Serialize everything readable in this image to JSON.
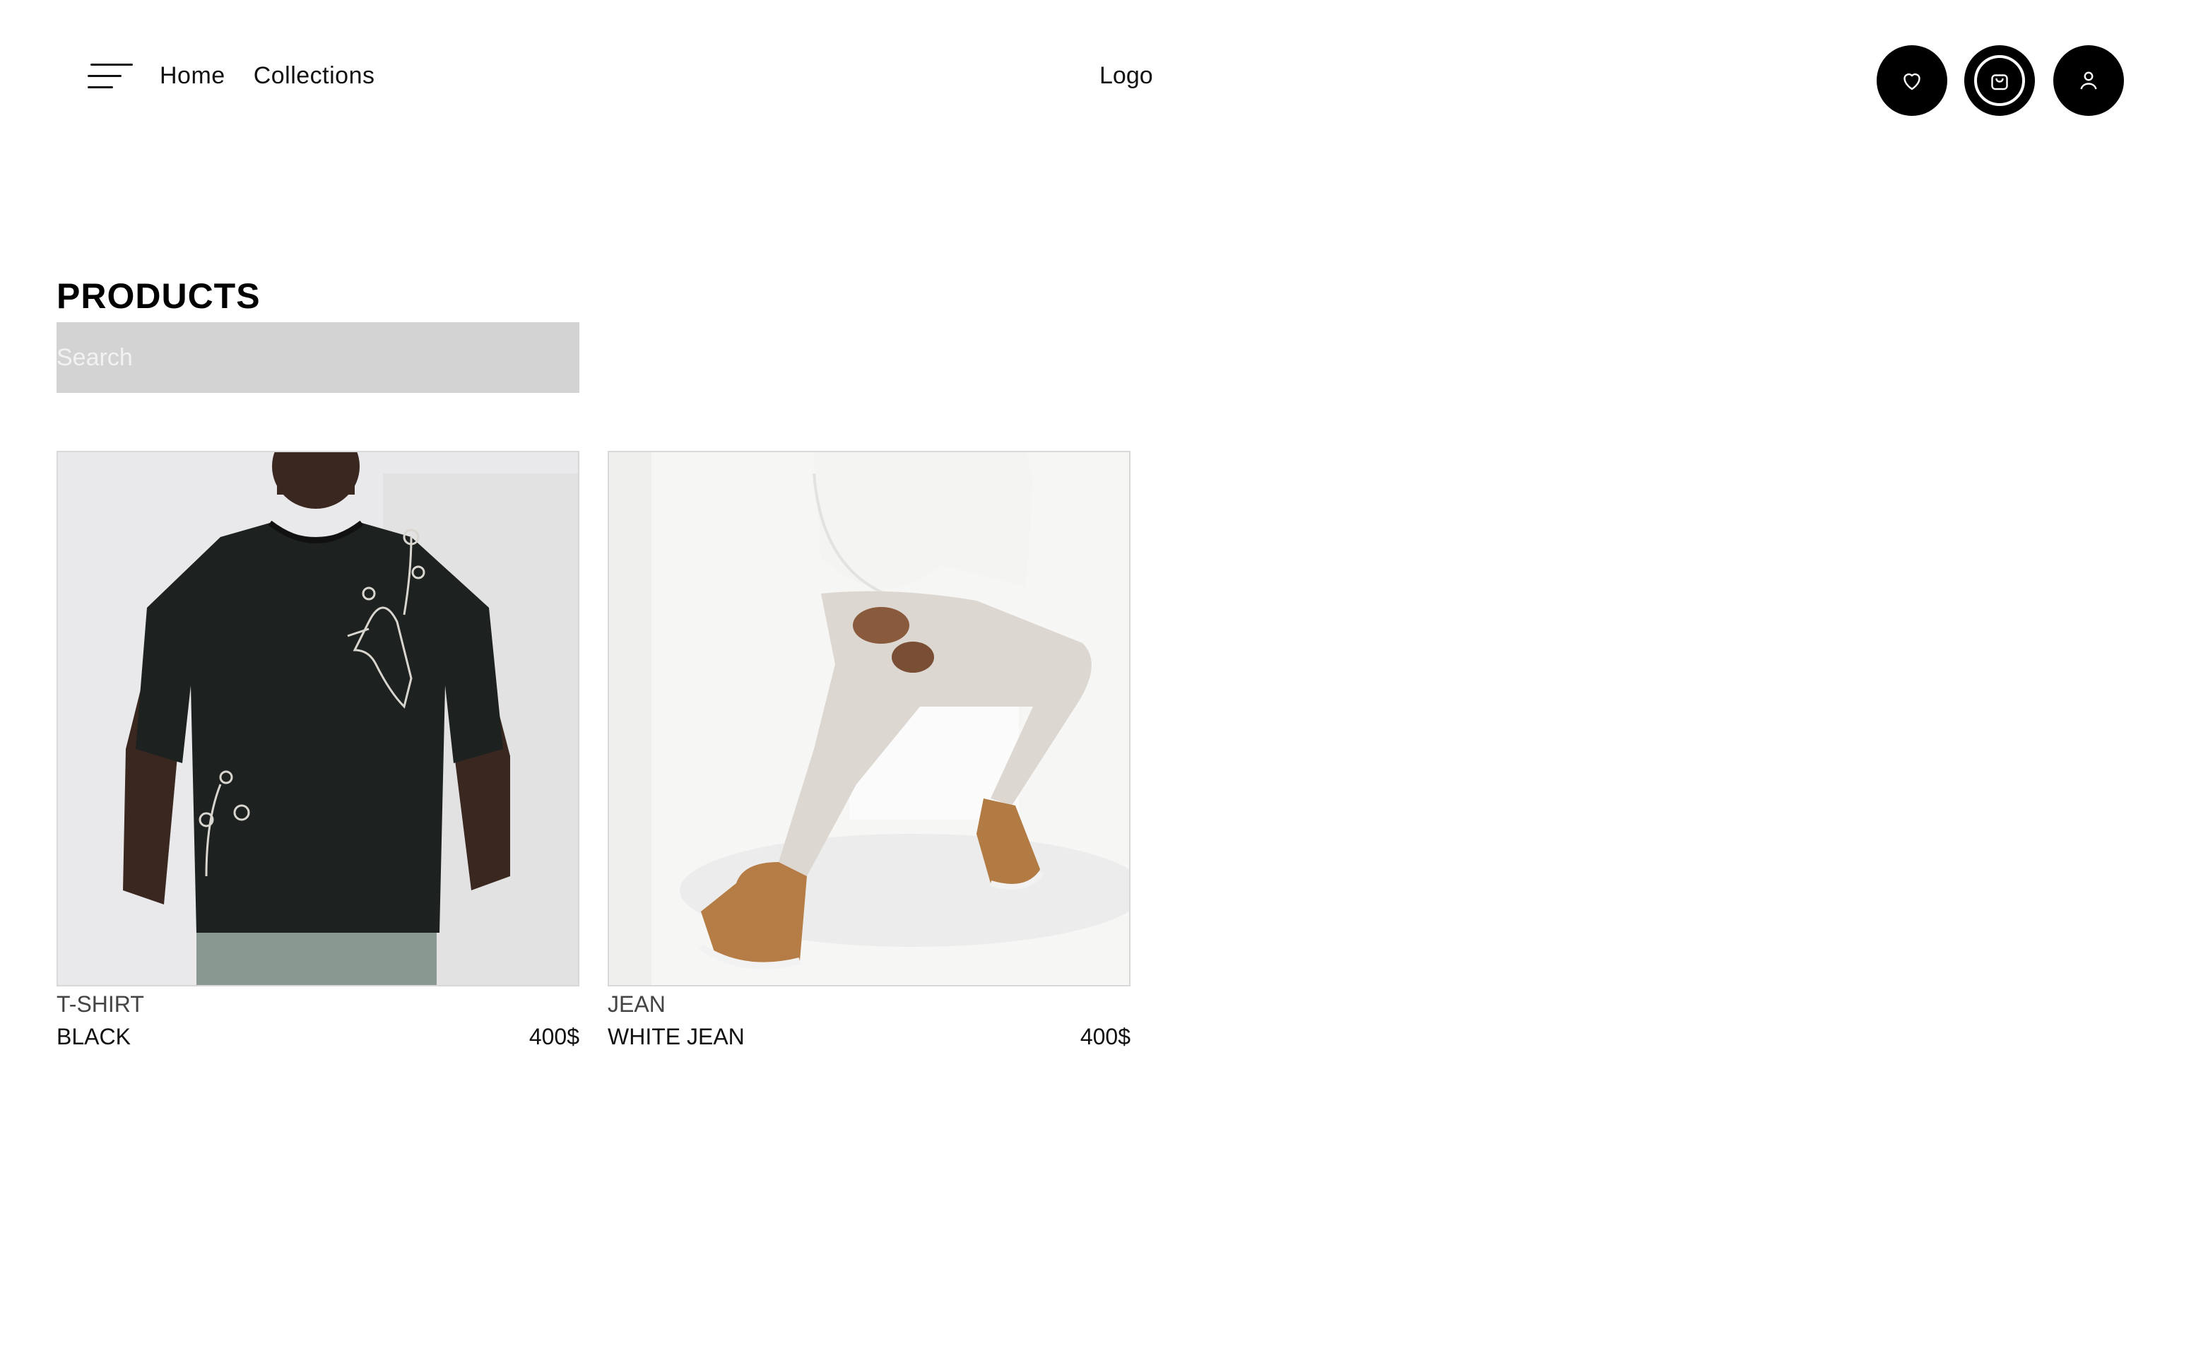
{
  "header": {
    "nav": [
      {
        "label": "Home"
      },
      {
        "label": "Collections"
      }
    ],
    "logo": "Logo",
    "icons": [
      "heart-icon",
      "shopping-bag-icon",
      "user-icon"
    ]
  },
  "page": {
    "title": "PRODUCTS"
  },
  "search": {
    "placeholder": "Search"
  },
  "products": [
    {
      "category": "T-SHIRT",
      "name": "BLACK",
      "price": "400$",
      "image": "black-tshirt-photo"
    },
    {
      "category": "JEAN",
      "name": "WHITE JEAN",
      "price": "400$",
      "image": "white-jean-photo"
    }
  ],
  "colors": {
    "icon_bg": "#000000",
    "search_bg": "#d3d3d3",
    "card_border": "#d8d8d8"
  }
}
